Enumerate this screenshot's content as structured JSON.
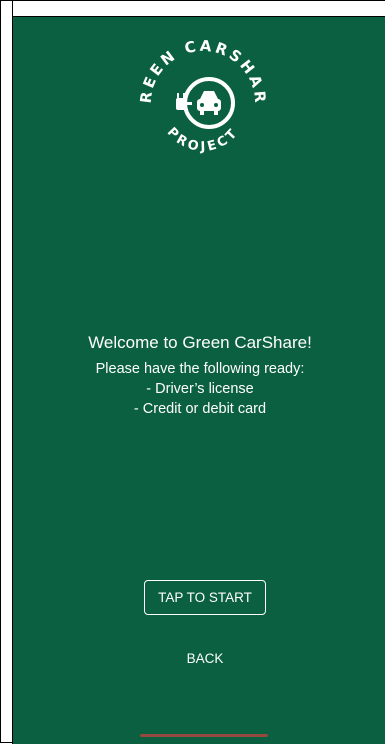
{
  "colors": {
    "background": "#0a6040",
    "foreground": "#ffffff"
  },
  "logo": {
    "top_text": "GREEN CARSHARE",
    "bottom_text": "PROJECT",
    "icon": "electric-car-plug-icon"
  },
  "welcome": {
    "title": "Welcome to Green CarShare!",
    "instruction": "Please have the following ready:",
    "items": [
      "- Driver’s license",
      "- Credit or debit card"
    ]
  },
  "actions": {
    "start_label": "TAP TO START",
    "back_label": "BACK"
  }
}
